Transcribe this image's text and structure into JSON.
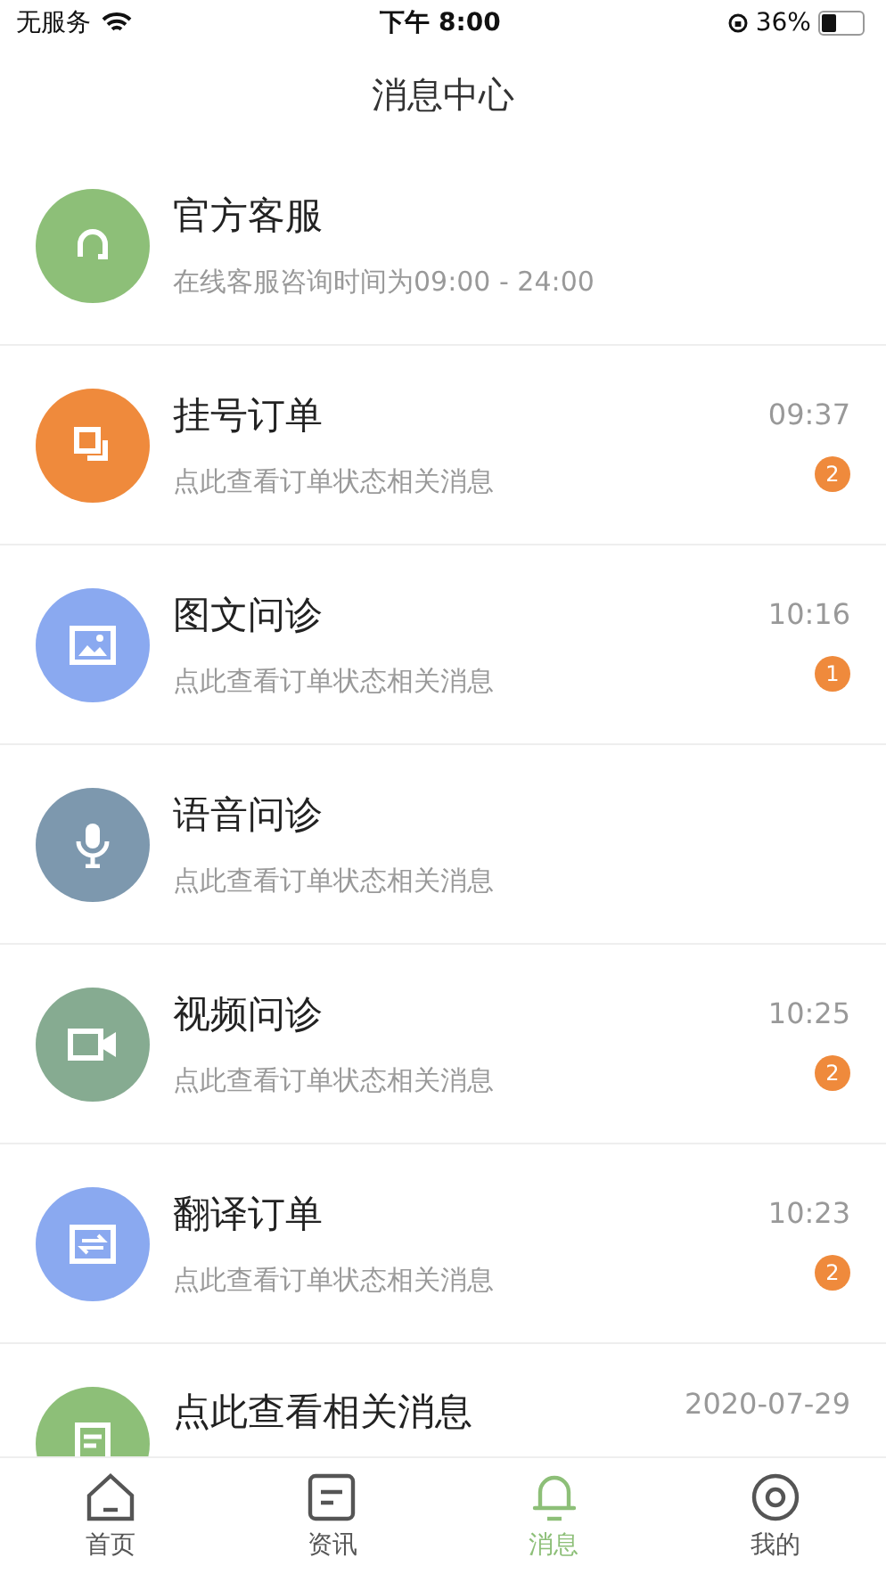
{
  "status_bar": {
    "carrier": "无服务",
    "time": "下午 8:00",
    "battery": "36%"
  },
  "title": "消息中心",
  "messages": [
    {
      "title": "官方客服",
      "subtitle": "在线客服咨询时间为09:00 - 24:00",
      "color": "#8dbf78"
    },
    {
      "title": "挂号订单",
      "subtitle": "点此查看订单状态相关消息",
      "time": "09:37",
      "badge": "2",
      "color": "#ef8a3c"
    },
    {
      "title": "图文问诊",
      "subtitle": "点此查看订单状态相关消息",
      "time": "10:16",
      "badge": "1",
      "color": "#8aa9f0"
    },
    {
      "title": "语音问诊",
      "subtitle": "点此查看订单状态相关消息",
      "color": "#7d98ae"
    },
    {
      "title": "视频问诊",
      "subtitle": "点此查看订单状态相关消息",
      "time": "10:25",
      "badge": "2",
      "color": "#86ab91"
    },
    {
      "title": "翻译订单",
      "subtitle": "点此查看订单状态相关消息",
      "time": "10:23",
      "badge": "2",
      "color": "#8aa9f0"
    },
    {
      "title": "点此查看相关消息",
      "time": "2020-07-29",
      "color": "#8dbf78"
    }
  ],
  "tabs": [
    {
      "label": "首页",
      "selected": false
    },
    {
      "label": "资讯",
      "selected": false
    },
    {
      "label": "消息",
      "selected": true
    },
    {
      "label": "我的",
      "selected": false
    }
  ]
}
